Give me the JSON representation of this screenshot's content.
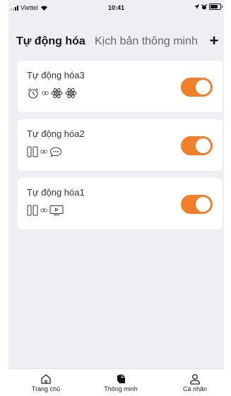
{
  "status_bar": {
    "carrier": "Viettel",
    "time": "10:41"
  },
  "tabs": {
    "active": "Tự động hóa",
    "other": "Kịch bản thông minh",
    "add_label": "+"
  },
  "automations": [
    {
      "name": "Tự động hóa3",
      "enabled": true,
      "icons": [
        "alarm-clock-icon",
        "link-icon",
        "atom-icon",
        "atom-icon"
      ]
    },
    {
      "name": "Tự động hóa2",
      "enabled": true,
      "icons": [
        "door-sensor-icon",
        "link-icon",
        "chat-bubble-icon"
      ]
    },
    {
      "name": "Tự động hóa1",
      "enabled": true,
      "icons": [
        "door-sensor-icon",
        "link-icon",
        "tv-icon"
      ]
    }
  ],
  "colors": {
    "accent": "#f07f2a",
    "background": "#eeeff3"
  },
  "bottom_nav": {
    "items": [
      {
        "label": "Trang chủ",
        "icon": "home-icon"
      },
      {
        "label": "Thông minh",
        "icon": "smart-icon"
      },
      {
        "label": "Cá nhân",
        "icon": "person-icon"
      }
    ]
  }
}
